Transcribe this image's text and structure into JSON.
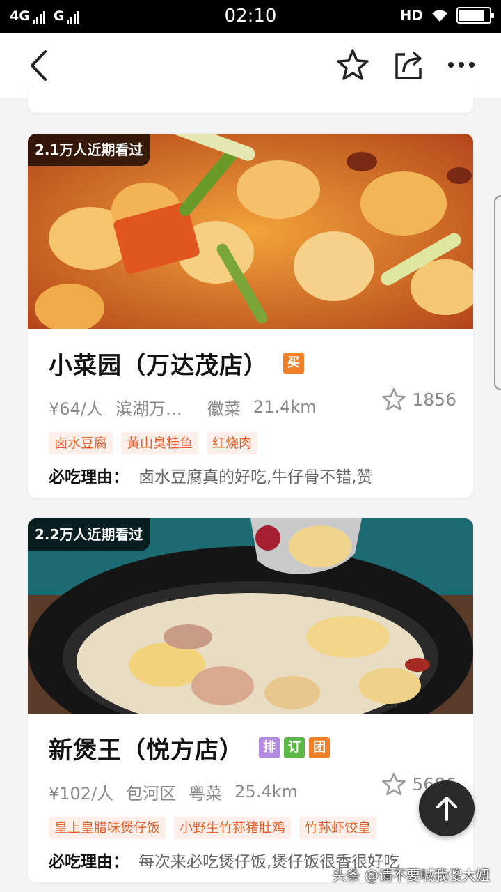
{
  "status_bar": {
    "network_left": "4G",
    "network_right": "G",
    "time": "02:10",
    "hd": "HD",
    "battery_level": 0.85
  },
  "nav": {
    "icons": [
      "back-arrow-icon",
      "star-icon",
      "share-icon",
      "more-icon"
    ]
  },
  "restaurants": [
    {
      "views_badge": "2.1万人近期看过",
      "name": "小菜园（万达茂店）",
      "badges": [
        {
          "label": "买",
          "color": "#f07f2a"
        }
      ],
      "price": "¥64/人",
      "area": "滨湖万…",
      "cuisine": "徽菜",
      "distance": "21.4km",
      "favorites": "1856",
      "dishes": [
        "卤水豆腐",
        "黄山臭桂鱼",
        "红烧肉"
      ],
      "reason_label": "必吃理由：",
      "reason": "卤水豆腐真的好吃,牛仔骨不错,赞"
    },
    {
      "views_badge": "2.2万人近期看过",
      "name": "新煲王（悦方店）",
      "badges": [
        {
          "label": "排",
          "color": "#b28ae0"
        },
        {
          "label": "订",
          "color": "#5bb846"
        },
        {
          "label": "团",
          "color": "#f07f2a"
        }
      ],
      "price": "¥102/人",
      "area": "包河区",
      "cuisine": "粤菜",
      "distance": "25.4km",
      "favorites": "5686",
      "dishes": [
        "皇上皇腊味煲仔饭",
        "小野生竹荪猪肚鸡",
        "竹荪虾饺皇"
      ],
      "reason_label": "必吃理由：",
      "reason": "每次来必吃煲仔饭,煲仔饭很香很好吃"
    }
  ],
  "fab_icon": "arrow-up-icon",
  "watermark": "头条 @请不要喊我傻大妞",
  "colors": {
    "accent": "#e8602c",
    "tag_bg": "#fdf0ea"
  }
}
